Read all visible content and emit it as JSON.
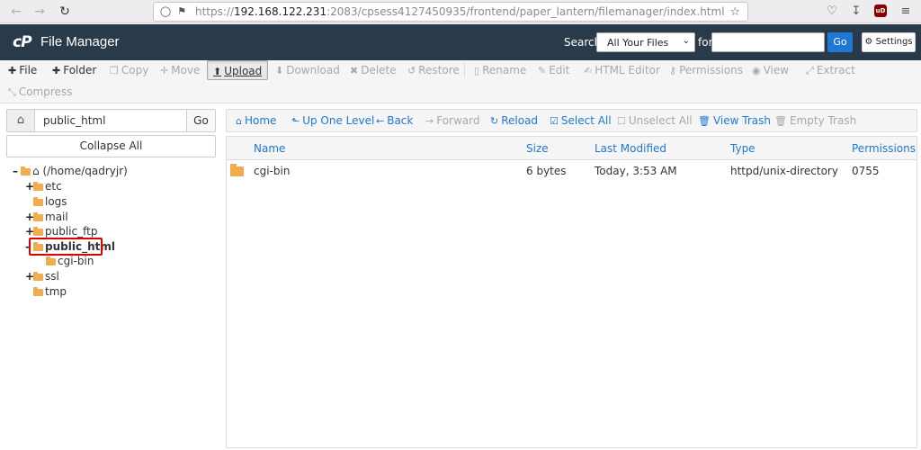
{
  "browser": {
    "url_prefix": "https://",
    "url_host": "192.168.122.231",
    "url_path": ":2083/cpsess4127450935/frontend/paper_lantern/filemanager/index.html",
    "ublock_label": "uD"
  },
  "header": {
    "logo": "cP",
    "title": "File Manager",
    "search_label": "Search",
    "search_scope": "All Your Files",
    "for_label": "for",
    "search_value": "",
    "go_label": "Go",
    "settings_label": "Settings"
  },
  "toolbar": {
    "file": "File",
    "folder": "Folder",
    "copy": "Copy",
    "move": "Move",
    "upload": "Upload",
    "download": "Download",
    "delete": "Delete",
    "restore": "Restore",
    "rename": "Rename",
    "edit": "Edit",
    "html_editor": "HTML Editor",
    "permissions": "Permissions",
    "view": "View",
    "extract": "Extract",
    "compress": "Compress"
  },
  "left": {
    "path_value": "public_html",
    "go_label": "Go",
    "collapse_label": "Collapse All",
    "tree": {
      "root": "(/home/qadryjr)",
      "etc": "etc",
      "logs": "logs",
      "mail": "mail",
      "public_ftp": "public_ftp",
      "public_html": "public_html",
      "cgi_bin": "cgi-bin",
      "ssl": "ssl",
      "tmp": "tmp"
    }
  },
  "right_toolbar": {
    "home": "Home",
    "up": "Up One Level",
    "back": "Back",
    "forward": "Forward",
    "reload": "Reload",
    "select_all": "Select All",
    "unselect_all": "Unselect All",
    "view_trash": "View Trash",
    "empty_trash": "Empty Trash"
  },
  "table": {
    "headers": {
      "name": "Name",
      "size": "Size",
      "last_modified": "Last Modified",
      "type": "Type",
      "permissions": "Permissions"
    },
    "rows": [
      {
        "name": "cgi-bin",
        "size": "6 bytes",
        "last_modified": "Today, 3:53 AM",
        "type": "httpd/unix-directory",
        "permissions": "0755"
      }
    ]
  }
}
